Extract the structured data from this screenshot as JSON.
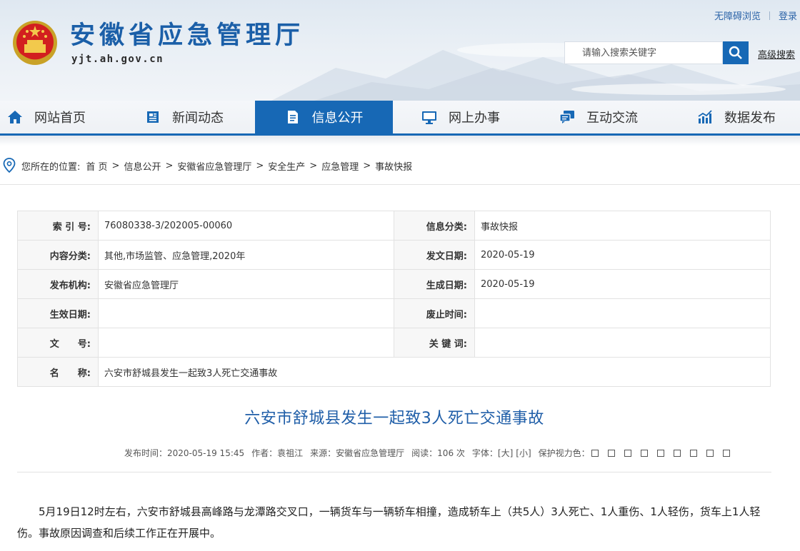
{
  "header": {
    "site_title": "安徽省应急管理厅",
    "site_domain": "yjt.ah.gov.cn",
    "accessibility_link": "无障碍浏览",
    "login_link": "登录",
    "search_placeholder": "请输入搜索关键字",
    "advanced_search": "高级搜索"
  },
  "nav": {
    "items": [
      {
        "label": "网站首页",
        "icon": "home-icon"
      },
      {
        "label": "新闻动态",
        "icon": "news-icon"
      },
      {
        "label": "信息公开",
        "icon": "document-icon",
        "active": true
      },
      {
        "label": "网上办事",
        "icon": "monitor-icon"
      },
      {
        "label": "互动交流",
        "icon": "chat-icon"
      },
      {
        "label": "数据发布",
        "icon": "chart-icon"
      }
    ],
    "active_color": "#1768b5"
  },
  "breadcrumb": {
    "prefix": "您所在的位置:",
    "items": [
      "首 页",
      "信息公开",
      "安徽省应急管理厅",
      "安全生产",
      "应急管理",
      "事故快报"
    ]
  },
  "info": {
    "index_label": "索 引 号:",
    "index_value": "76080338-3/202005-00060",
    "category_label": "信息分类:",
    "category_value": "事故快报",
    "content_label": "内容分类:",
    "content_value": "其他,市场监管、应急管理,2020年",
    "issue_date_label": "发文日期:",
    "issue_date_value": "2020-05-19",
    "publisher_label": "发布机构:",
    "publisher_value": "安徽省应急管理厅",
    "generate_date_label": "生成日期:",
    "generate_date_value": "2020-05-19",
    "effective_label": "生效日期:",
    "effective_value": "",
    "abolish_label": "废止时间:",
    "abolish_value": "",
    "doc_no_label": "文　　号:",
    "doc_no_value": "",
    "keywords_label": "关 键 词:",
    "keywords_value": "",
    "name_label": "名　　称:",
    "name_value": "六安市舒城县发生一起致3人死亡交通事故"
  },
  "article": {
    "title": "六安市舒城县发生一起致3人死亡交通事故",
    "publish_time": "发布时间：2020-05-19 15:45",
    "author": "作者：袁祖江",
    "source": "来源：安徽省应急管理厅",
    "views": "阅读：106 次",
    "font_label": "字体：",
    "font_large": "[大]",
    "font_small": "[小]",
    "protect_label": "保护视力色：",
    "body": "5月19日12时左右，六安市舒城县高峰路与龙潭路交叉口，一辆货车与一辆轿车相撞，造成轿车上（共5人）3人死亡、1人重伤、1人轻伤，货车上1人轻伤。事故原因调查和后续工作正在开展中。"
  }
}
